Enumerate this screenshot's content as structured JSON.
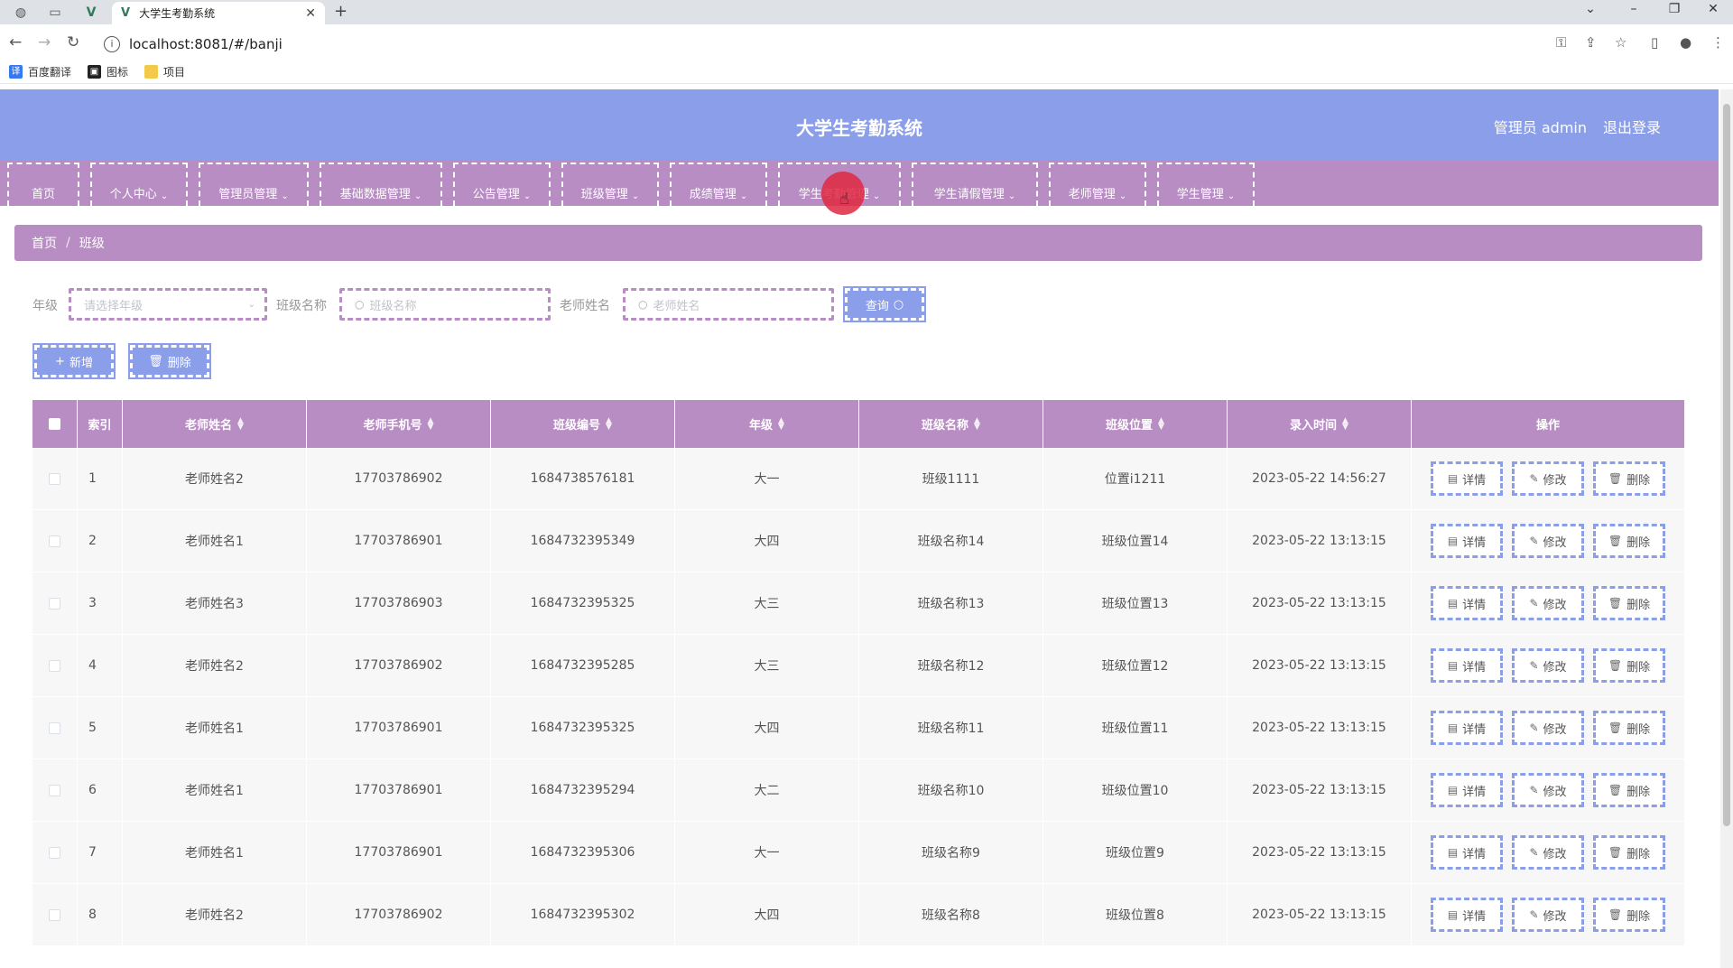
{
  "browser": {
    "tab_title": "大学生考勤系统",
    "url": "localhost:8081/#/banji",
    "bookmarks": [
      "百度翻译",
      "图标",
      "项目"
    ]
  },
  "app": {
    "title": "大学生考勤系统",
    "user_label": "管理员 admin",
    "logout_label": "退出登录",
    "accent_color": "#8b9ee9",
    "secondary_color": "#b88dc3"
  },
  "nav": [
    "首页",
    "个人中心",
    "管理员管理",
    "基础数据管理",
    "公告管理",
    "班级管理",
    "成绩管理",
    "学生考勤管理",
    "学生请假管理",
    "老师管理",
    "学生管理"
  ],
  "breadcrumb": [
    "首页",
    "班级"
  ],
  "search": {
    "grade_label": "年级",
    "grade_placeholder": "请选择年级",
    "class_name_label": "班级名称",
    "class_name_placeholder": "班级名称",
    "teacher_label": "老师姓名",
    "teacher_placeholder": "老师姓名",
    "query_button": "查询"
  },
  "actions": {
    "add_label": "新增",
    "delete_label": "删除"
  },
  "table": {
    "columns": [
      "索引",
      "老师姓名",
      "老师手机号",
      "班级编号",
      "年级",
      "班级名称",
      "班级位置",
      "录入时间",
      "操作"
    ],
    "row_actions": [
      "详情",
      "修改",
      "删除"
    ],
    "rows": [
      [
        "1",
        "老师姓名2",
        "17703786902",
        "1684738576181",
        "大一",
        "班级1111",
        "位置i1211",
        "2023-05-22 14:56:27"
      ],
      [
        "2",
        "老师姓名1",
        "17703786901",
        "1684732395349",
        "大四",
        "班级名称14",
        "班级位置14",
        "2023-05-22 13:13:15"
      ],
      [
        "3",
        "老师姓名3",
        "17703786903",
        "1684732395325",
        "大三",
        "班级名称13",
        "班级位置13",
        "2023-05-22 13:13:15"
      ],
      [
        "4",
        "老师姓名2",
        "17703786902",
        "1684732395285",
        "大三",
        "班级名称12",
        "班级位置12",
        "2023-05-22 13:13:15"
      ],
      [
        "5",
        "老师姓名1",
        "17703786901",
        "1684732395325",
        "大四",
        "班级名称11",
        "班级位置11",
        "2023-05-22 13:13:15"
      ],
      [
        "6",
        "老师姓名1",
        "17703786901",
        "1684732395294",
        "大二",
        "班级名称10",
        "班级位置10",
        "2023-05-22 13:13:15"
      ],
      [
        "7",
        "老师姓名1",
        "17703786901",
        "1684732395306",
        "大一",
        "班级名称9",
        "班级位置9",
        "2023-05-22 13:13:15"
      ],
      [
        "8",
        "老师姓名2",
        "17703786902",
        "1684732395302",
        "大四",
        "班级名称8",
        "班级位置8",
        "2023-05-22 13:13:15"
      ]
    ]
  }
}
